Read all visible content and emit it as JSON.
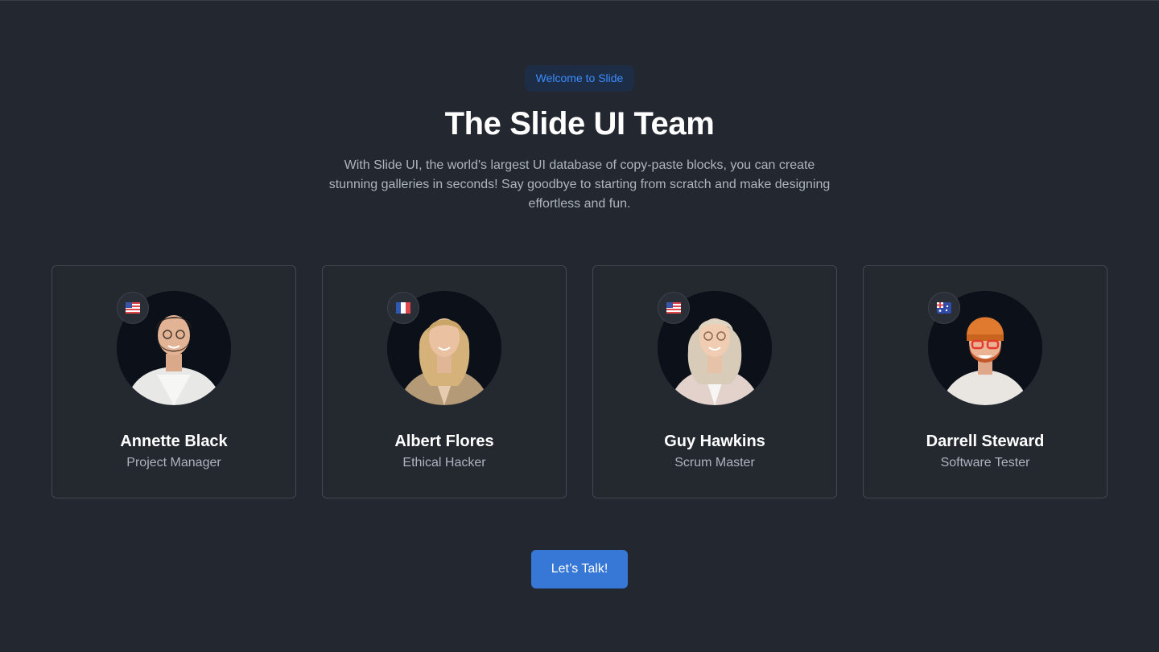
{
  "hero": {
    "badge": "Welcome to Slide",
    "title": "The Slide UI Team",
    "description": "With Slide UI, the world's largest UI database of copy-paste blocks, you can create stunning galleries in seconds! Say goodbye to starting from scratch and make designing effortless and fun."
  },
  "team": [
    {
      "name": "Annette Black",
      "role": "Project Manager",
      "flag_icon": "us-flag-icon"
    },
    {
      "name": "Albert Flores",
      "role": "Ethical Hacker",
      "flag_icon": "france-flag-icon"
    },
    {
      "name": "Guy Hawkins",
      "role": "Scrum Master",
      "flag_icon": "us-flag-icon"
    },
    {
      "name": "Darrell Steward",
      "role": "Software Tester",
      "flag_icon": "australia-flag-icon"
    }
  ],
  "cta": {
    "label": "Let’s Talk!"
  },
  "colors": {
    "background": "#232830",
    "accent": "#3778d6",
    "badge_text": "#3b8cff"
  }
}
